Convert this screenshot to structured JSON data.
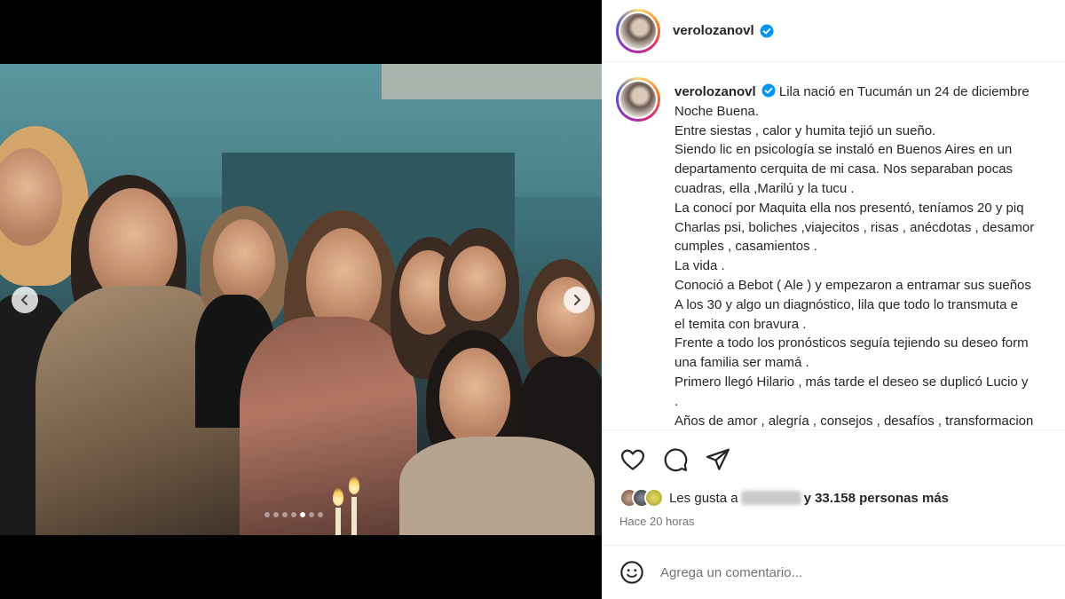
{
  "post": {
    "username": "verolozanovl",
    "verified": true,
    "caption_lines": [
      "Lila nació en Tucumán un 24 de diciembre",
      "Noche Buena.",
      "Entre siestas , calor y humita tejió un sueño.",
      "Siendo lic en psicología se instaló en Buenos Aires en un",
      "departamento cerquita de mi casa. Nos separaban pocas",
      "cuadras, ella ,Marilú y la tucu .",
      "La conocí por Maquita ella nos presentó, teníamos 20 y piq",
      "Charlas psi, boliches ,viajecitos , risas , anécdotas , desamor",
      "cumples , casamientos .",
      "La vida .",
      "Conoció a Bebot ( Ale ) y empezaron a entramar sus sueños",
      "A los 30 y algo un diagnóstico, lila que todo lo transmuta e",
      "el temita con bravura .",
      "Frente a todo los pronósticos seguía tejiendo su deseo form",
      "una familia ser mamá .",
      "Primero llegó Hilario , más tarde el deseo se duplicó Lucio y",
      ".",
      "Años de amor , alegría , consejos , desafíos , transformacion"
    ],
    "likes_prefix": "Les gusta a",
    "likes_suffix": "y 33.158 personas más",
    "time_ago": "Hace 20 horas",
    "comment_placeholder": "Agrega un comentario...",
    "carousel": {
      "slide_count": 7,
      "active_index": 4
    }
  },
  "icons": {
    "like": "heart-icon",
    "comment": "comment-icon",
    "share": "share-icon",
    "emoji": "emoji-icon",
    "prev": "chevron-left-icon",
    "next": "chevron-right-icon",
    "verified": "verified-badge-icon"
  },
  "colors": {
    "verified_blue": "#0095f6",
    "text": "#262626",
    "muted": "#737373"
  }
}
